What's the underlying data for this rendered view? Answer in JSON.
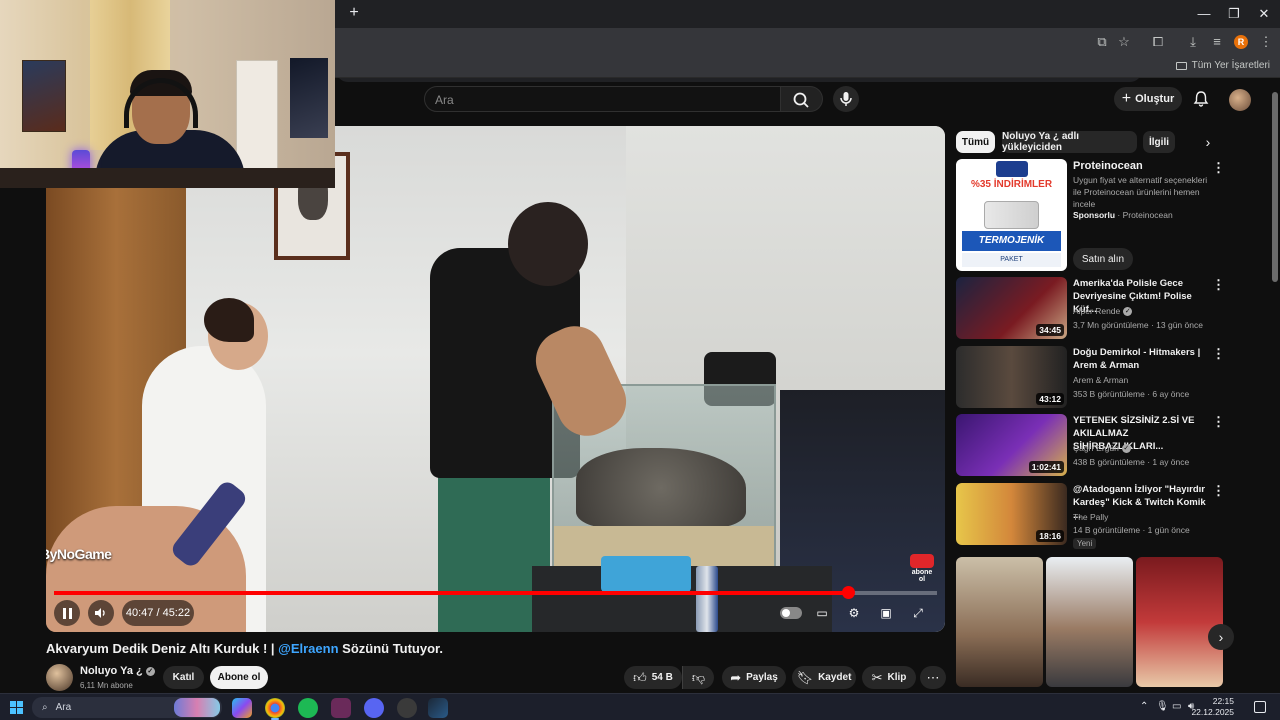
{
  "browser": {
    "bookmarks_all": "Tüm Yer İşaretleri",
    "profile_initial": "R"
  },
  "youtube": {
    "search_placeholder": "Ara",
    "create_label": "Oluştur"
  },
  "player": {
    "time": "40:47 / 45:22",
    "progress": 0.899,
    "watermark": "ByNoGame",
    "subscribe_watermark": "abone ol"
  },
  "video": {
    "title_prefix": "Akvaryum Dedik Deniz Altı Kurduk ! | ",
    "title_mention": "@Elraenn",
    "title_suffix": " Sözünü Tutuyor.",
    "channel_name": "Noluyo Ya ¿",
    "channel_subs": "6,11 Mn abone",
    "join_label": "Katıl",
    "subscribe_label": "Abone ol",
    "likes": "54 B",
    "share_label": "Paylaş",
    "save_label": "Kaydet",
    "clip_label": "Klip"
  },
  "chips": [
    "Tümü",
    "Noluyo Ya ¿ adlı yükleyiciden",
    "İlgili"
  ],
  "ad": {
    "title": "Proteinocean",
    "description": "Uygun fiyat ve alternatif seçenekleri ile Proteinocean ürünlerini hemen incele",
    "sponsor_label": "Sponsorlu",
    "sponsor_name": " · Proteinocean",
    "cta": "Satın alın",
    "thumb_discount": "%35 İNDİRİMLER",
    "thumb_product": "TERMOJENİK",
    "thumb_sub": "PAKET"
  },
  "recommendations": [
    {
      "title": "Amerika'da Polisle Gece Devriyesine Çıktım! Polise Küf...",
      "channel": "Alper Rende",
      "verified": true,
      "meta": "3,7 Mn görüntüleme · 13 gün önce",
      "duration": "34:45",
      "badge": ""
    },
    {
      "title": "Doğu Demirkol - Hitmakers | Arem & Arman",
      "channel": "Arem & Arman",
      "verified": false,
      "meta": "353 B görüntüleme · 6 ay önce",
      "duration": "43:12",
      "badge": ""
    },
    {
      "title": "YETENEK SİZSİNİZ 2.Sİ VE AKILALMAZ SİHİRBAZLIKLARI...",
      "channel": "Çağrı Ergün",
      "verified": true,
      "meta": "438 B görüntüleme · 1 ay önce",
      "duration": "1:02:41",
      "badge": ""
    },
    {
      "title": "@Atadogann İzliyor \"Hayırdır Kardeş\" Kick & Twitch Komik ...",
      "channel": "The Pally",
      "verified": false,
      "meta": "14 B görüntüleme · 1 gün önce",
      "duration": "18:16",
      "badge": "Yeni"
    }
  ],
  "taskbar": {
    "search_label": "Ara",
    "time": "22:15",
    "date": "22.12.2025"
  }
}
